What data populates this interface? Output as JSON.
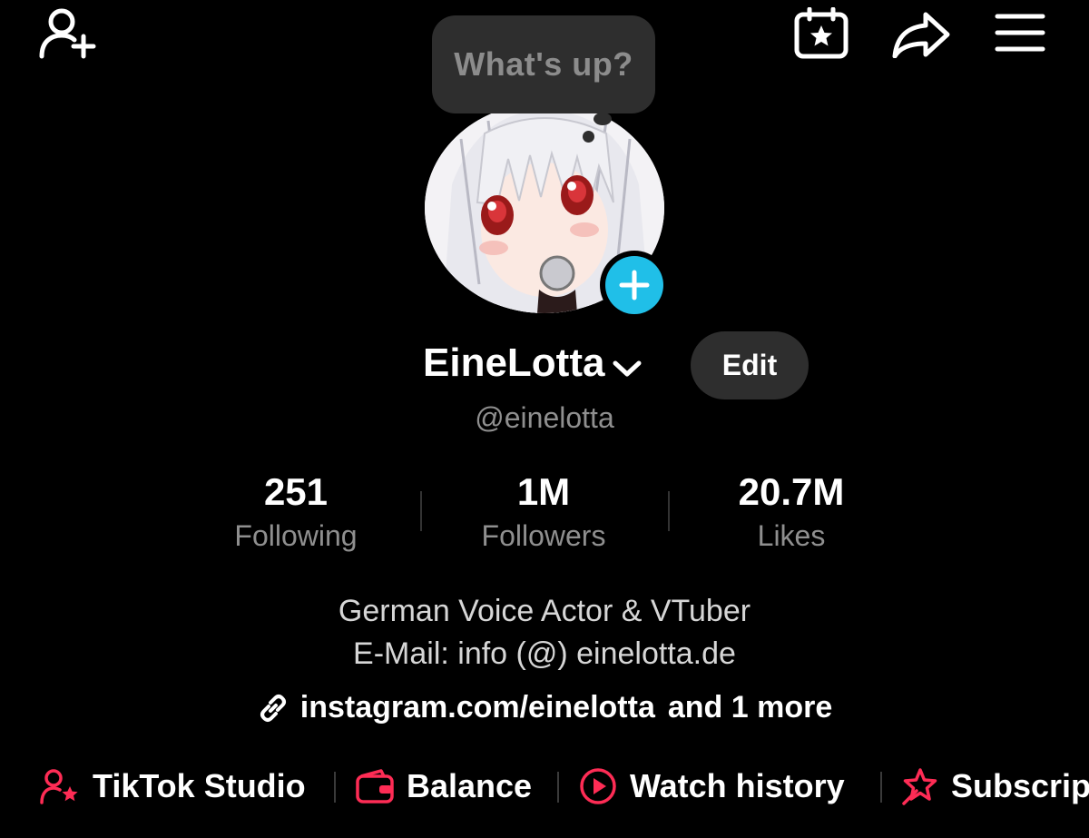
{
  "header": {
    "icons": [
      "add-friend-icon",
      "calendar-star-icon",
      "share-icon",
      "menu-icon"
    ]
  },
  "bubble": {
    "text": "What's up?"
  },
  "profile": {
    "display_name": "EineLotta",
    "edit_label": "Edit",
    "handle": "@einelotta"
  },
  "stats": [
    {
      "value": "251",
      "label": "Following"
    },
    {
      "value": "1M",
      "label": "Followers"
    },
    {
      "value": "20.7M",
      "label": "Likes"
    }
  ],
  "bio": {
    "line1": "German Voice Actor & VTuber",
    "line2": "E-Mail: info (@) einelotta.de"
  },
  "link": {
    "url": "instagram.com/einelotta",
    "more": "and 1 more"
  },
  "shortcuts": [
    {
      "label": "TikTok Studio",
      "icon": "person-star-icon"
    },
    {
      "label": "Balance",
      "icon": "wallet-icon"
    },
    {
      "label": "Watch history",
      "icon": "play-circle-icon"
    },
    {
      "label": "Subscrip",
      "icon": "star-badge-icon"
    }
  ],
  "colors": {
    "background": "#000000",
    "accent_red": "#fe2c55",
    "plus_blue": "#20bfe8",
    "muted_text": "#8f8f8f",
    "button_bg": "#2e2e2e"
  }
}
